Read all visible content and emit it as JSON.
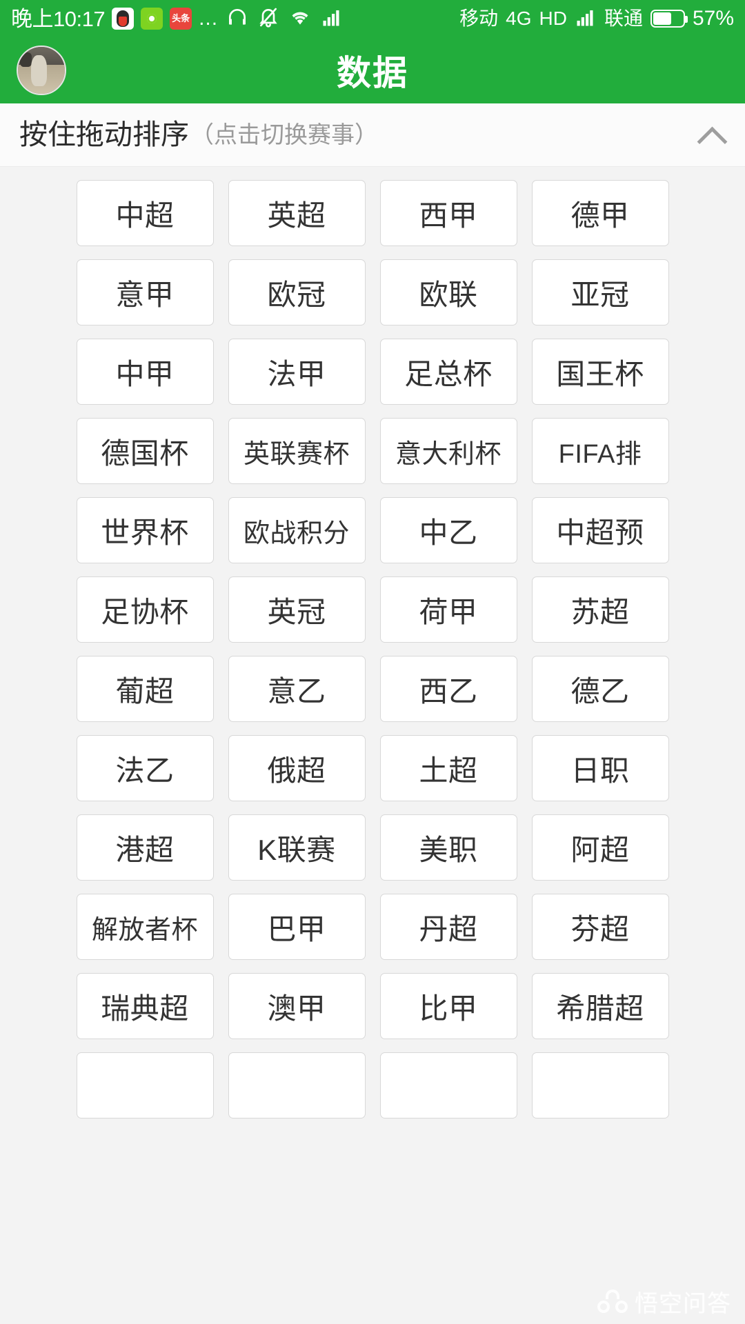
{
  "status_bar": {
    "time": "晚上10:17",
    "app_icons": [
      {
        "name": "qq-icon",
        "label": ""
      },
      {
        "name": "green-app-icon",
        "label": ""
      },
      {
        "name": "toutiao-icon",
        "label": "头条"
      }
    ],
    "overflow": "...",
    "icons": [
      "headset-icon",
      "bell-muted-icon",
      "wifi-icon",
      "signal-icon"
    ],
    "carrier_1": "移动",
    "network_type": "4G",
    "hd_label": "HD",
    "carrier_2": "联通",
    "battery_percent": "57%",
    "battery_level": 57
  },
  "title_bar": {
    "title": "数据",
    "avatar_name": "user-avatar"
  },
  "section_header": {
    "main_text": "按住拖动排序",
    "sub_text": "（点击切换赛事）",
    "collapse_icon": "chevron-up-icon"
  },
  "grid": {
    "tiles": [
      "中超",
      "英超",
      "西甲",
      "德甲",
      "意甲",
      "欧冠",
      "欧联",
      "亚冠",
      "中甲",
      "法甲",
      "足总杯",
      "国王杯",
      "德国杯",
      "英联赛杯",
      "意大利杯",
      "FIFA排",
      "世界杯",
      "欧战积分",
      "中乙",
      "中超预",
      "足协杯",
      "英冠",
      "荷甲",
      "苏超",
      "葡超",
      "意乙",
      "西乙",
      "德乙",
      "法乙",
      "俄超",
      "土超",
      "日职",
      "港超",
      "K联赛",
      "美职",
      "阿超",
      "解放者杯",
      "巴甲",
      "丹超",
      "芬超",
      "瑞典超",
      "澳甲",
      "比甲",
      "希腊超",
      "",
      "",
      "",
      ""
    ]
  },
  "watermark": {
    "text": "悟空问答"
  },
  "colors": {
    "brand_green": "#22ad3c",
    "page_background": "#f3f3f3",
    "tile_background": "#ffffff",
    "tile_border": "#d8d8d8",
    "text_primary": "#333333",
    "text_muted": "#9a9a9a"
  }
}
